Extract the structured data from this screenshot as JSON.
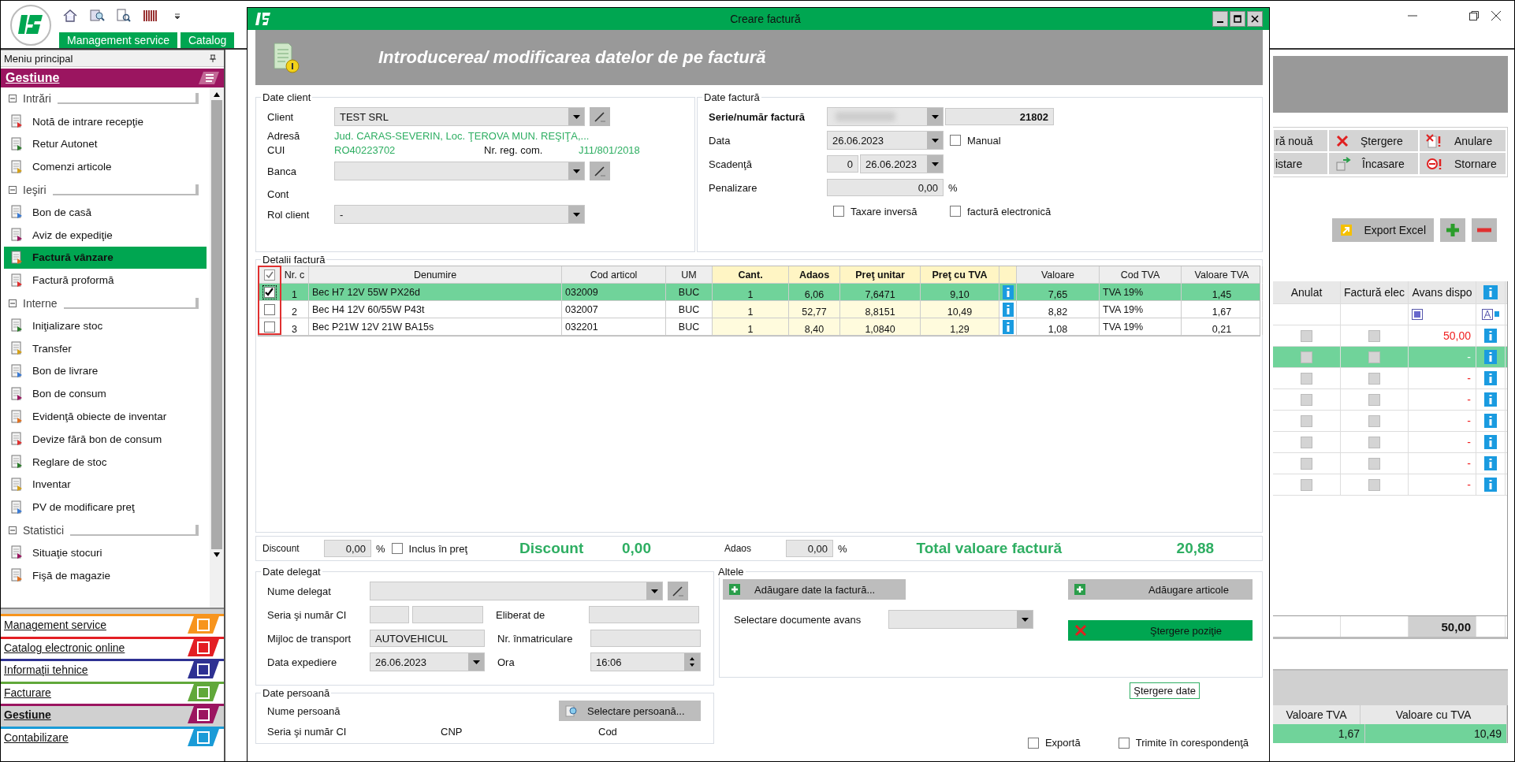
{
  "app": {
    "tabs": [
      "Management service",
      "Catalog"
    ]
  },
  "sidebar": {
    "title": "Meniu principal",
    "section": "Gestiune",
    "groups": [
      {
        "label": "Intrări",
        "expanded": true,
        "items": [
          {
            "label": "Notă de intrare recepţie",
            "selected": false
          },
          {
            "label": "Retur Autonet",
            "selected": false
          },
          {
            "label": "Comenzi articole",
            "selected": false
          }
        ]
      },
      {
        "label": "Ieşiri",
        "expanded": true,
        "items": [
          {
            "label": "Bon de casă",
            "selected": false
          },
          {
            "label": "Aviz de expediţie",
            "selected": false
          },
          {
            "label": "Factură vânzare",
            "selected": true
          },
          {
            "label": "Factură proformă",
            "selected": false
          }
        ]
      },
      {
        "label": "Interne",
        "expanded": true,
        "items": [
          {
            "label": "Iniţializare stoc",
            "selected": false
          },
          {
            "label": "Transfer",
            "selected": false
          },
          {
            "label": "Bon de livrare",
            "selected": false
          },
          {
            "label": "Bon de consum",
            "selected": false
          },
          {
            "label": "Evidenţă obiecte de inventar",
            "selected": false
          },
          {
            "label": "Devize fără bon de consum",
            "selected": false
          },
          {
            "label": "Reglare de stoc",
            "selected": false
          },
          {
            "label": "Inventar",
            "selected": false
          },
          {
            "label": "PV de modificare preţ",
            "selected": false
          }
        ]
      },
      {
        "label": "Statistici",
        "expanded": true,
        "items": [
          {
            "label": "Situaţie stocuri",
            "selected": false
          },
          {
            "label": "Fişă de magazie",
            "selected": false
          }
        ]
      }
    ],
    "modules": [
      {
        "label": "Management service",
        "color": "#f7941d",
        "selected": false
      },
      {
        "label": "Catalog electronic online",
        "color": "#e31e24",
        "selected": false
      },
      {
        "label": "Informaţii tehnice",
        "color": "#2e3192",
        "selected": false
      },
      {
        "label": "Facturare",
        "color": "#61a83a",
        "selected": false
      },
      {
        "label": "Gestiune",
        "color": "#9b1560",
        "selected": true
      },
      {
        "label": "Contabilizare",
        "color": "#1a9bd7",
        "selected": false
      }
    ]
  },
  "background": {
    "buttons": [
      "ră nouă",
      "Ştergere",
      "Anulare",
      "istare",
      "Încasare",
      "Stornare"
    ],
    "export_button": "Export Excel",
    "columns": [
      "Anulat",
      "Factură elec",
      "Avans dispo"
    ],
    "rows": [
      {
        "cancelled": false,
        "einvoice": false,
        "advance": "50,00",
        "selected": false
      },
      {
        "cancelled": false,
        "einvoice": false,
        "advance": "-",
        "selected": true
      },
      {
        "cancelled": false,
        "einvoice": false,
        "advance": "-",
        "selected": false
      },
      {
        "cancelled": false,
        "einvoice": false,
        "advance": "-",
        "selected": false
      },
      {
        "cancelled": false,
        "einvoice": false,
        "advance": "-",
        "selected": false
      },
      {
        "cancelled": false,
        "einvoice": false,
        "advance": "-",
        "selected": false
      },
      {
        "cancelled": false,
        "einvoice": false,
        "advance": "-",
        "selected": false
      },
      {
        "cancelled": false,
        "einvoice": false,
        "advance": "-",
        "selected": false
      }
    ],
    "total": "50,00",
    "detail_columns": [
      "Valoare TVA",
      "Valoare cu TVA"
    ],
    "detail_rows": [
      {
        "cells": [
          "1,67",
          "10,49"
        ],
        "selected": true
      }
    ]
  },
  "dialog": {
    "title": "Creare factură",
    "heading": "Introducerea/ modificarea datelor de pe factură",
    "client": {
      "legend": "Date client",
      "client_label": "Client",
      "client_value": "TEST SRL",
      "address_label": "Adresă",
      "address": "Jud. CARAS-SEVERIN, Loc. ŢEROVA MUN. REŞIŢA,...",
      "cui_label": "CUI",
      "cui": "RO40223702",
      "reg_label": "Nr. reg. com.",
      "reg": "J11/801/2018",
      "bank_label": "Banca",
      "account_label": "Cont",
      "role_label": "Rol client",
      "role_value": "-"
    },
    "invoice": {
      "legend": "Date factură",
      "series_label": "Serie/număr factură",
      "number": "21802",
      "date_label": "Data",
      "date": "26.06.2023",
      "manual": {
        "label": "Manual",
        "checked": false
      },
      "due_label": "Scadenţă",
      "due_days": "0",
      "due_date": "26.06.2023",
      "penalty_label": "Penalizare",
      "penalty": "0,00",
      "penalty_unit": "%",
      "reverse": {
        "label": "Taxare inversă",
        "checked": false
      },
      "einvoice": {
        "label": "factură electronică",
        "checked": false
      }
    },
    "details": {
      "legend": "Detalii factură",
      "all_checked": true,
      "columns": [
        {
          "label": "Nr. c",
          "kind": "text"
        },
        {
          "label": "Denumire",
          "kind": "text"
        },
        {
          "label": "Cod articol",
          "kind": "text"
        },
        {
          "label": "UM",
          "kind": "text"
        },
        {
          "label": "Cant.",
          "kind": "editable"
        },
        {
          "label": "Adaos",
          "kind": "editable"
        },
        {
          "label": "Preţ unitar",
          "kind": "editable"
        },
        {
          "label": "Preţ cu TVA",
          "kind": "editable"
        },
        {
          "kind": "info"
        },
        {
          "label": "Valoare",
          "kind": "text"
        },
        {
          "label": "Cod TVA",
          "kind": "text"
        },
        {
          "label": "Valoare TVA",
          "kind": "text"
        }
      ],
      "rows": [
        {
          "checked": true,
          "selected": true,
          "cells": [
            "1",
            "Bec H7 12V 55W PX26d",
            "032009",
            "BUC",
            "1",
            "6,06",
            "7,6471",
            "9,10",
            "",
            "7,65",
            "TVA 19%",
            "1,45"
          ]
        },
        {
          "checked": false,
          "selected": false,
          "cells": [
            "2",
            "Bec H4 12V 60/55W P43t",
            "032007",
            "BUC",
            "1",
            "52,77",
            "8,8151",
            "10,49",
            "",
            "8,82",
            "TVA 19%",
            "1,67"
          ]
        },
        {
          "checked": false,
          "selected": false,
          "cells": [
            "3",
            "Bec P21W 12V 21W BA15s",
            "032201",
            "BUC",
            "1",
            "8,40",
            "1,0840",
            "1,29",
            "",
            "1,08",
            "TVA 19%",
            "0,21"
          ]
        }
      ]
    },
    "summary": {
      "discount_label": "Discount",
      "discount": "0,00",
      "discount_unit": "%",
      "included": {
        "label": "Inclus în preţ",
        "checked": false
      },
      "discount_title": "Discount",
      "discount_total": "0,00",
      "markup_label": "Adaos",
      "markup": "0,00",
      "markup_unit": "%",
      "total_label": "Total valoare factură",
      "total": "20,88"
    },
    "delegate": {
      "legend": "Date delegat",
      "name_label": "Nume delegat",
      "id_label": "Seria şi număr CI",
      "issued_label": "Eliberat de",
      "transport_label": "Mijloc de transport",
      "transport": "AUTOVEHICUL",
      "plate_label": "Nr. înmatriculare",
      "ship_label": "Data expediere",
      "ship_date": "26.06.2023",
      "time_label": "Ora",
      "time": "16:06"
    },
    "person": {
      "legend": "Date persoană",
      "name_label": "Nume persoană",
      "select_button": "Selectare persoană...",
      "id_label": "Seria şi număr CI",
      "cnp_label": "CNP",
      "code_label": "Cod"
    },
    "other": {
      "legend": "Altele",
      "add_data_button": "Adăugare date la factură...",
      "advance_label": "Selectare documente avans",
      "add_items_button": "Adăugare articole",
      "delete_row_button": "Ştergere poziţie",
      "clear_button": "Ştergere date"
    },
    "export": {
      "label": "Exportă",
      "checked": false
    },
    "mail": {
      "label": "Trimite în corespondenţă",
      "checked": false
    }
  }
}
